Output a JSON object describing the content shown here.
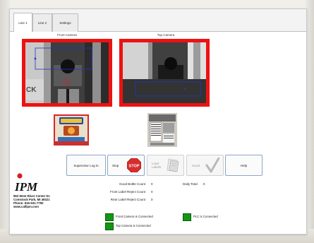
{
  "tabs": [
    {
      "label": "Line 1",
      "active": true
    },
    {
      "label": "Line 2",
      "active": false
    },
    {
      "label": "Settings",
      "active": false
    }
  ],
  "cameras": {
    "front": {
      "title": "Front Camera"
    },
    "top": {
      "title": "Top Camera"
    }
  },
  "buttons": {
    "supervisor": "Supervisor Log In",
    "stop": "Stop",
    "stop_sign": "STOP",
    "load_labels": "Load Labels",
    "good": "Good",
    "help": "Help"
  },
  "logo": {
    "text": "IPM"
  },
  "address": {
    "line1": "963 West River Center Dr.",
    "line2": "Comstock Park, MI 49321",
    "line3": "Phone: 616-531-7750",
    "line4": "www.callipm.com"
  },
  "stats": {
    "good_bottle_label": "Good Bottle Count",
    "good_bottle_value": "0",
    "front_reject_label": "Front Label Reject Count",
    "front_reject_value": "0",
    "rear_reject_label": "Rear Label Reject Count",
    "rear_reject_value": "0",
    "daily_total_label": "Daily Total",
    "daily_total_value": "0"
  },
  "status": {
    "front_camera": "Front Camera is Connected",
    "top_camera": "Top Camera is Connected",
    "plc": "PLC is Connected",
    "connected_color": "#139613"
  },
  "colors": {
    "camera_border": "#ee1111",
    "button_border": "#8da5c8"
  }
}
